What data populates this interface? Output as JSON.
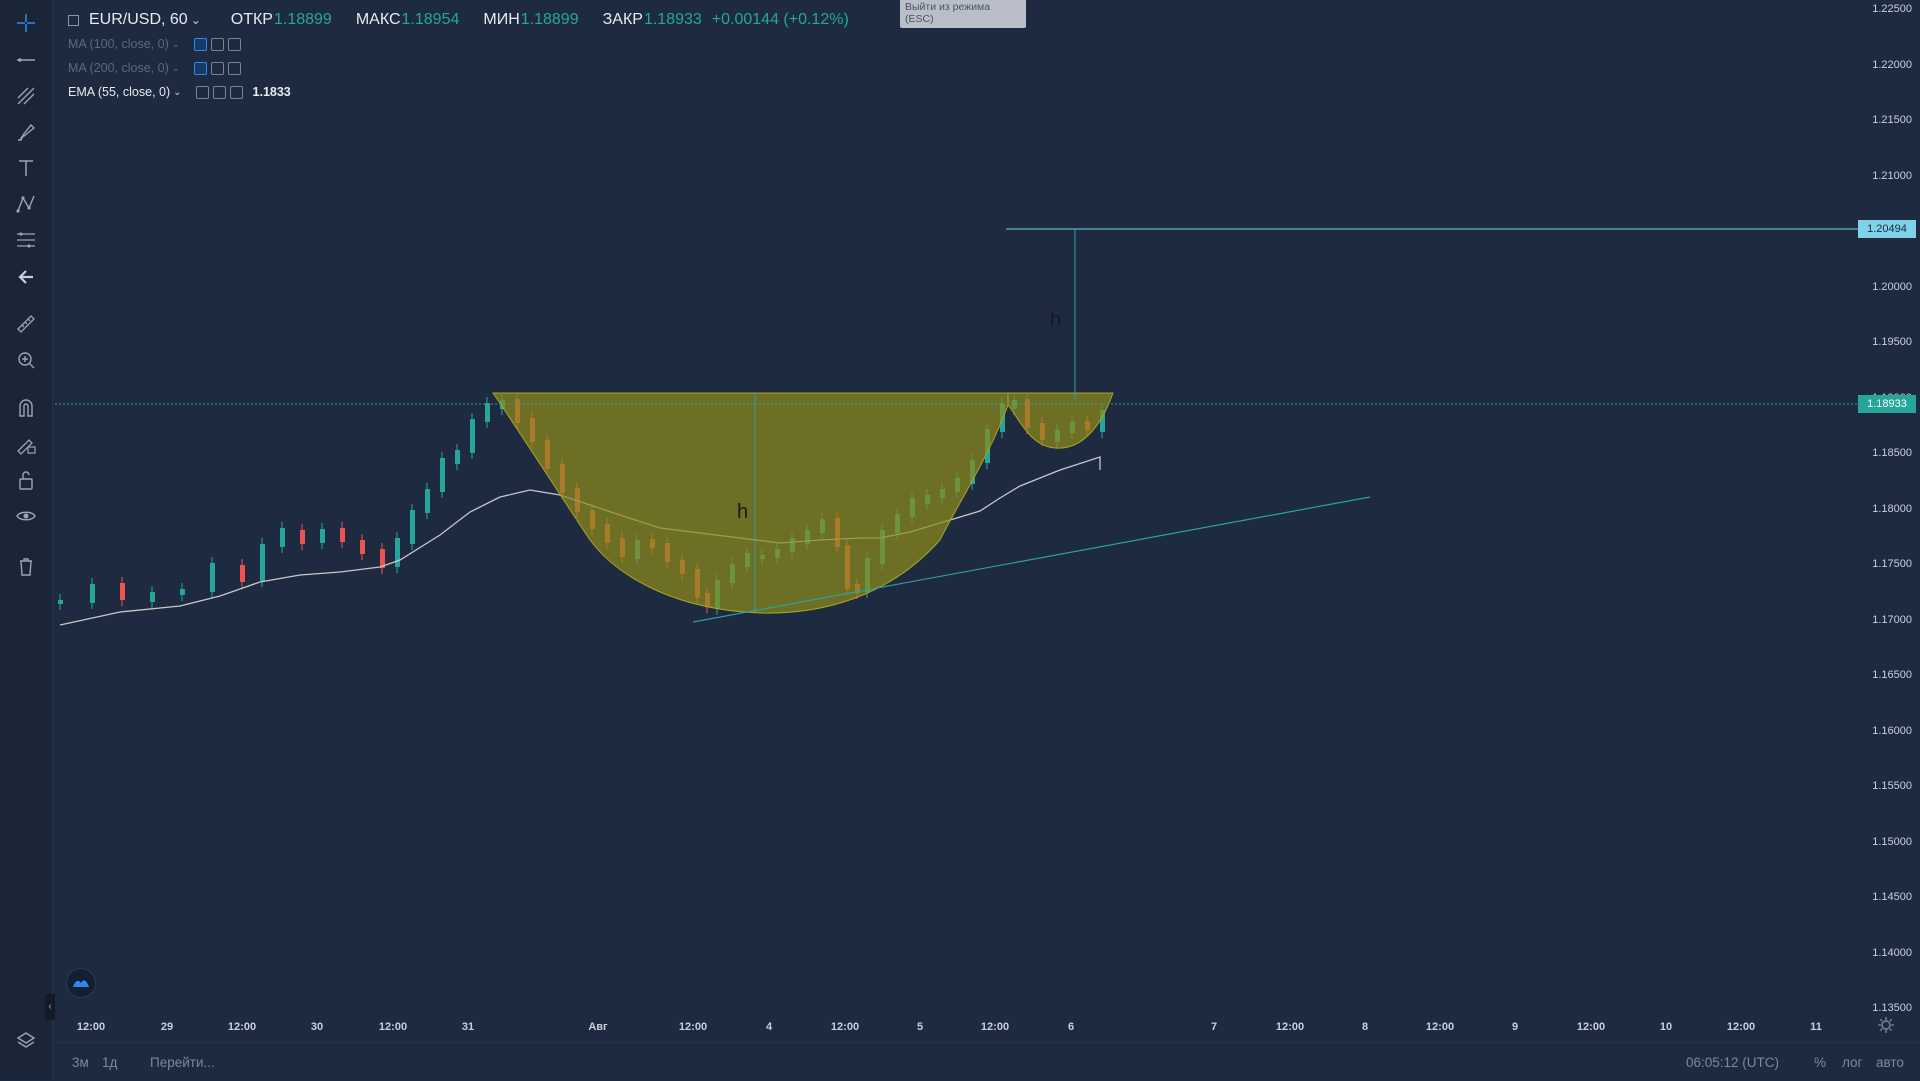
{
  "colors": {
    "background": "#1e2a3f",
    "up": "#26a69a",
    "down": "#ef5350",
    "cup_fill": "#8a8a1a",
    "trendline": "#2f9f9f",
    "target_line": "#7fd2e8",
    "ema": "#c8c8c8",
    "ma": "#9a9a88"
  },
  "legend": {
    "symbol": "EUR/USD, 60",
    "open_label": "ОТКР",
    "open_value": "1.18899",
    "high_label": "МАКС",
    "high_value": "1.18954",
    "low_label": "МИН",
    "low_value": "1.18899",
    "close_label": "ЗАКР",
    "close_value": "1.18933",
    "change": "+0.00144 (+0.12%)",
    "indicators": [
      {
        "label": "MA (100, close, 0)",
        "value": ""
      },
      {
        "label": "MA (200, close, 0)",
        "value": ""
      },
      {
        "label": "EMA (55, close, 0)",
        "value": "1.1833"
      }
    ]
  },
  "tooltip": {
    "text": "Выйти из режима (ESC)"
  },
  "annotations": {
    "h1": "h",
    "h2": "h"
  },
  "price_axis": {
    "labels": [
      "1.22500",
      "1.22000",
      "1.21500",
      "1.21000",
      "1.20500",
      "1.20000",
      "1.19500",
      "1.19000",
      "1.18500",
      "1.18000",
      "1.17500",
      "1.17000",
      "1.16500",
      "1.16000",
      "1.15500",
      "1.15000",
      "1.14500",
      "1.14000",
      "1.13500"
    ],
    "target_tag": "1.20494",
    "last_price_tag": "1.18933"
  },
  "time_axis": {
    "labels": [
      "12:00",
      "29",
      "12:00",
      "30",
      "12:00",
      "31",
      "Авг",
      "12:00",
      "4",
      "12:00",
      "5",
      "12:00",
      "6",
      "7",
      "12:00",
      "8",
      "12:00",
      "9",
      "12:00",
      "10",
      "12:00",
      "11"
    ]
  },
  "bottom_bar": {
    "range_3m": "3м",
    "range_1d": "1д",
    "goto": "Перейти...",
    "clock": "06:05:12 (UTC)",
    "percent": "%",
    "log": "лог",
    "auto": "авто"
  },
  "tools": [
    "crosshair-icon",
    "trend-line-icon",
    "pitchfork-icon",
    "brush-icon",
    "text-icon",
    "pattern-icon",
    "fib-icon",
    "back-arrow-icon",
    "ruler-icon",
    "zoom-in-icon",
    "magnet-icon",
    "lock-drawing-icon",
    "unlock-icon",
    "eye-icon",
    "trash-icon"
  ]
}
